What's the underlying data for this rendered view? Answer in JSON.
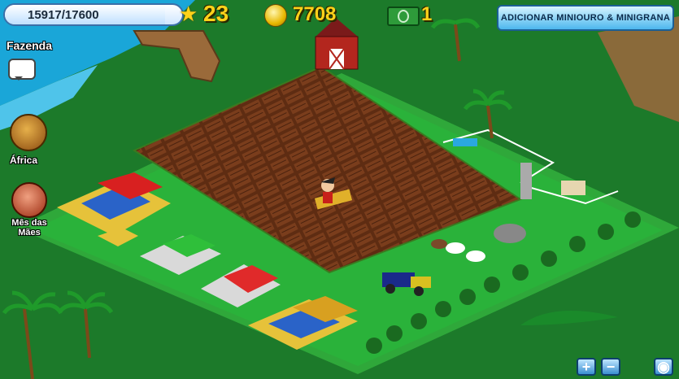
{
  "hud": {
    "xp_text": "15917/17600",
    "xp_fraction": 0.904,
    "level": "23",
    "coins": "7708",
    "cash": "1",
    "add_button_label": "ADICIONAR MINIOURO & MINIGRANA"
  },
  "sidebar": {
    "farm_label": "Fazenda",
    "africa_label": "África",
    "moms_label": "Mês das Mães"
  },
  "controls": {
    "zoom_in": "+",
    "zoom_out": "−",
    "view": "◉"
  },
  "colors": {
    "grass": "#1f8a2e",
    "grass_light": "#2fa83a",
    "river": "#1aa6d8",
    "soil": "#6b3418",
    "soil_row": "#4a220e",
    "coin_gold": "#ffd21a",
    "button_blue": "#4db7ee"
  }
}
